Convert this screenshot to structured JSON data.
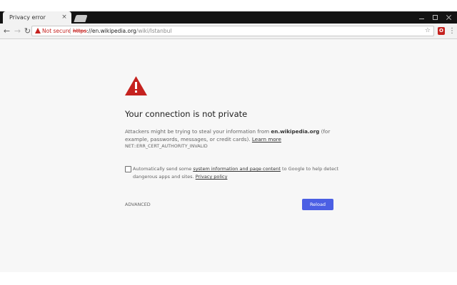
{
  "browser": {
    "tab_title": "Privacy error",
    "tab_close": "×",
    "nav": {
      "back": "←",
      "forward": "→",
      "reload": "↻"
    },
    "omnibox": {
      "security_label": "Not secure",
      "url_scheme": "https",
      "url_host": "://en.wikipedia.org",
      "url_path": "/wiki/Istanbul"
    },
    "star": "☆",
    "extension_label": "O",
    "menu": "⋮"
  },
  "interstitial": {
    "title": "Your connection is not private",
    "message_pre": "Attackers might be trying to steal your information from ",
    "message_host": "en.wikipedia.org",
    "message_post": " (for example, passwords, messages, or credit cards). ",
    "learn_more": "Learn more",
    "error_code": "NET::ERR_CERT_AUTHORITY_INVALID",
    "opt_pre": "Automatically send some ",
    "opt_link": "system information and page content",
    "opt_mid": " to Google to help detect dangerous apps and sites. ",
    "privacy_link": "Privacy policy",
    "advanced": "ADVANCED",
    "reload": "Reload"
  },
  "colors": {
    "warning_red": "#c5221f",
    "reload_button": "#4b5fe4",
    "page_background": "#f7f7f7"
  }
}
